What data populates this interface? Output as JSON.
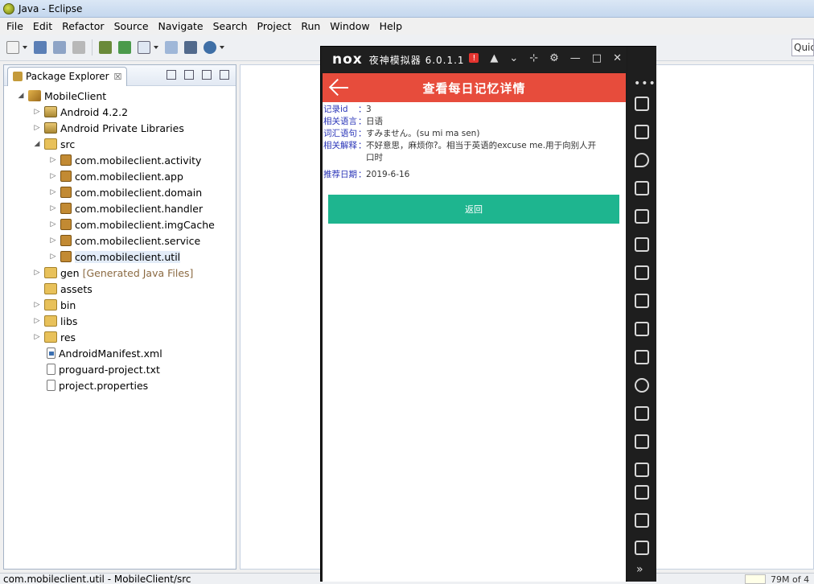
{
  "window": {
    "title": "Java - Eclipse"
  },
  "menu": [
    "File",
    "Edit",
    "Refactor",
    "Source",
    "Navigate",
    "Search",
    "Project",
    "Run",
    "Window",
    "Help"
  ],
  "toolbar": {
    "quick_access": "Quic"
  },
  "explorer": {
    "tab_label": "Package Explorer",
    "tab_close": "☒",
    "tree": [
      {
        "label": "MobileClient",
        "depth": 0,
        "expanded": true,
        "icon": "project-icon"
      },
      {
        "label": "Android 4.2.2",
        "depth": 1,
        "expanded": false,
        "icon": "library-icon"
      },
      {
        "label": "Android Private Libraries",
        "depth": 1,
        "expanded": false,
        "icon": "library-icon"
      },
      {
        "label": "src",
        "depth": 1,
        "expanded": true,
        "icon": "source-folder-icon"
      },
      {
        "label": "com.mobileclient.activity",
        "depth": 2,
        "expanded": false,
        "icon": "package-icon"
      },
      {
        "label": "com.mobileclient.app",
        "depth": 2,
        "expanded": false,
        "icon": "package-icon"
      },
      {
        "label": "com.mobileclient.domain",
        "depth": 2,
        "expanded": false,
        "icon": "package-icon"
      },
      {
        "label": "com.mobileclient.handler",
        "depth": 2,
        "expanded": false,
        "icon": "package-icon"
      },
      {
        "label": "com.mobileclient.imgCache",
        "depth": 2,
        "expanded": false,
        "icon": "package-icon"
      },
      {
        "label": "com.mobileclient.service",
        "depth": 2,
        "expanded": false,
        "icon": "package-icon"
      },
      {
        "label": "com.mobileclient.util",
        "depth": 2,
        "expanded": false,
        "icon": "package-icon",
        "selected": true
      },
      {
        "label": "gen",
        "decoration": "[Generated Java Files]",
        "depth": 1,
        "expanded": false,
        "icon": "source-folder-icon"
      },
      {
        "label": "assets",
        "depth": 1,
        "expanded": null,
        "icon": "folder-icon"
      },
      {
        "label": "bin",
        "depth": 1,
        "expanded": false,
        "icon": "folder-icon"
      },
      {
        "label": "libs",
        "depth": 1,
        "expanded": false,
        "icon": "folder-icon"
      },
      {
        "label": "res",
        "depth": 1,
        "expanded": false,
        "icon": "folder-icon"
      },
      {
        "label": "AndroidManifest.xml",
        "depth": 1,
        "expanded": null,
        "icon": "xml-file-icon"
      },
      {
        "label": "proguard-project.txt",
        "depth": 1,
        "expanded": null,
        "icon": "file-icon"
      },
      {
        "label": "project.properties",
        "depth": 1,
        "expanded": null,
        "icon": "file-icon"
      }
    ]
  },
  "statusbar": {
    "text": "com.mobileclient.util - MobileClient/src",
    "memory": "79M of 4"
  },
  "emulator": {
    "logo": "nox",
    "title": "夜神模拟器 6.0.1.1",
    "badge": "!",
    "app": {
      "title": "查看每日记忆详情",
      "fields": [
        {
          "label": "记录id",
          "value": "3"
        },
        {
          "label": "相关语言",
          "value": "日语"
        },
        {
          "label": "词汇语句",
          "value": "すみません。(su mi ma sen)"
        },
        {
          "label": "相关解释",
          "value": "不好意思，麻烦你?。相当于英语的excuse me.用于向别人开口时"
        },
        {
          "label": "推荐日期",
          "value": "2019-6-16"
        }
      ],
      "return_label": "返回"
    }
  }
}
